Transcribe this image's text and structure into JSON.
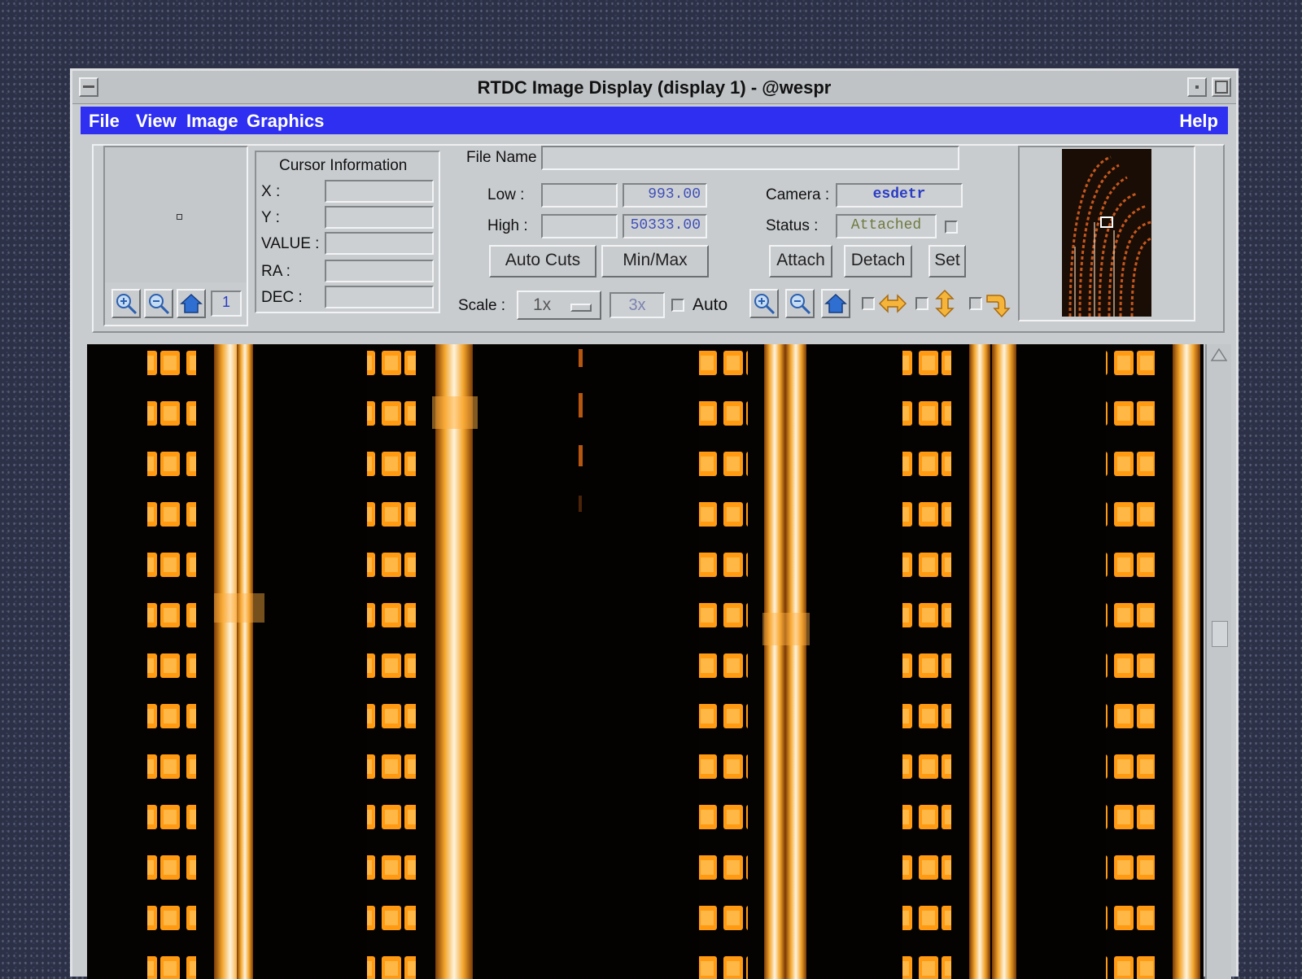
{
  "window": {
    "title": "RTDC Image Display (display 1) - @wespr"
  },
  "menu": {
    "file": "File",
    "view": "View",
    "image": "Image",
    "graphics": "Graphics",
    "help": "Help"
  },
  "panner": {
    "zoom_level": "1",
    "zoom_in_icon": "zoom-in-icon",
    "zoom_out_icon": "zoom-out-icon",
    "home_icon": "home-icon"
  },
  "cursor_info": {
    "heading": "Cursor Information",
    "x_label": "X :",
    "y_label": "Y :",
    "value_label": "VALUE :",
    "ra_label": "RA :",
    "dec_label": "DEC :"
  },
  "file": {
    "label": "File Name",
    "value": ""
  },
  "cuts": {
    "low_label": "Low :",
    "high_label": "High :",
    "low_input": "",
    "high_input": "",
    "low_value": "993.00",
    "high_value": "50333.00",
    "auto_cuts": "Auto Cuts",
    "min_max": "Min/Max"
  },
  "camera": {
    "label": "Camera :",
    "value": "esdetr",
    "status_label": "Status :",
    "status_value": "Attached",
    "attach": "Attach",
    "detach": "Detach",
    "set": "Set"
  },
  "scale": {
    "label": "Scale :",
    "selected": "1x",
    "value": "3x",
    "auto_label": "Auto"
  },
  "colors": {
    "menubar": "#2f2ff2",
    "field_text": "#3f50b8",
    "camera_text": "#2a3cc4",
    "status_text": "#6f7a40",
    "image_orange": "#ffa21a"
  }
}
